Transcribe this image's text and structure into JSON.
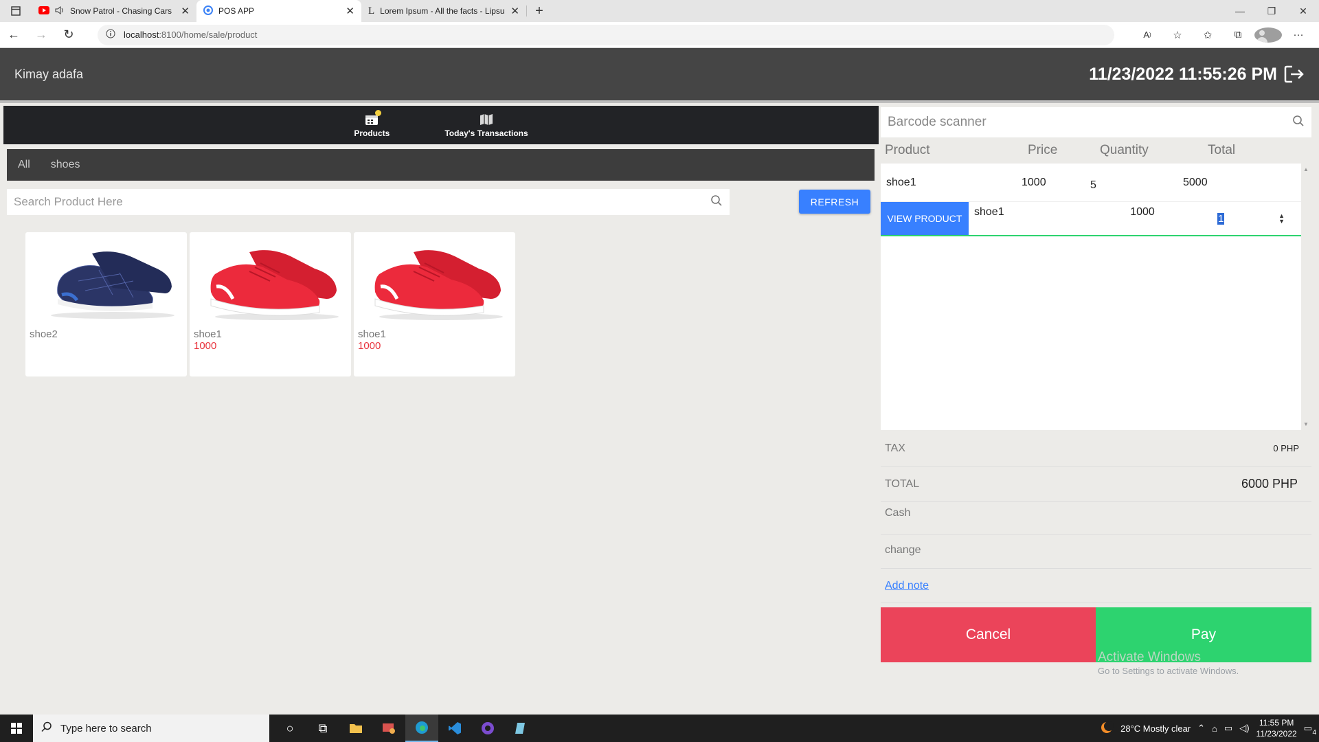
{
  "browser": {
    "tabs": [
      {
        "title": "Snow Patrol - Chasing Cars",
        "icon": "youtube-icon",
        "active": false
      },
      {
        "title": "POS APP",
        "icon": "app-icon",
        "active": true
      },
      {
        "title": "Lorem Ipsum - All the facts - Lipsum",
        "icon": "lipsum-icon",
        "active": false
      }
    ],
    "url_host": "localhost",
    "url_path": ":8100/home/sale/product"
  },
  "header": {
    "user_name": "Kimay adafa",
    "datetime": "11/23/2022 11:55:26 PM"
  },
  "nav": {
    "products_label": "Products",
    "transactions_label": "Today's Transactions"
  },
  "categories": [
    "All",
    "shoes"
  ],
  "search": {
    "placeholder": "Search Product Here"
  },
  "refresh_label": "REFRESH",
  "products": [
    {
      "name": "shoe2",
      "price": "",
      "color": "#283469"
    },
    {
      "name": "shoe1",
      "price": "1000",
      "color": "#e8283a"
    },
    {
      "name": "shoe1",
      "price": "1000",
      "color": "#e8283a"
    }
  ],
  "barcode": {
    "placeholder": "Barcode scanner"
  },
  "cart": {
    "headers": {
      "product": "Product",
      "price": "Price",
      "quantity": "Quantity",
      "total": "Total"
    },
    "row1": {
      "product": "shoe1",
      "price": "1000",
      "quantity": "5",
      "total": "5000"
    },
    "row2": {
      "view_label": "VIEW PRODUCT",
      "product": "shoe1",
      "price": "1000",
      "quantity": "1"
    }
  },
  "summary": {
    "tax_label": "TAX",
    "tax_value": "0 PHP",
    "total_label": "TOTAL",
    "total_value": "6000 PHP",
    "cash_label": "Cash",
    "change_label": "change",
    "add_note": "Add note"
  },
  "actions": {
    "cancel": "Cancel",
    "pay": "Pay"
  },
  "watermark": {
    "line1": "Activate Windows",
    "line2": "Go to Settings to activate Windows."
  },
  "taskbar": {
    "search_placeholder": "Type here to search",
    "weather": "28°C  Mostly clear",
    "time": "11:55 PM",
    "date": "11/23/2022",
    "notifications": "4"
  },
  "colors": {
    "primary": "#3880ff",
    "success": "#2dd36f",
    "danger": "#eb445a",
    "price": "#e8323c"
  }
}
